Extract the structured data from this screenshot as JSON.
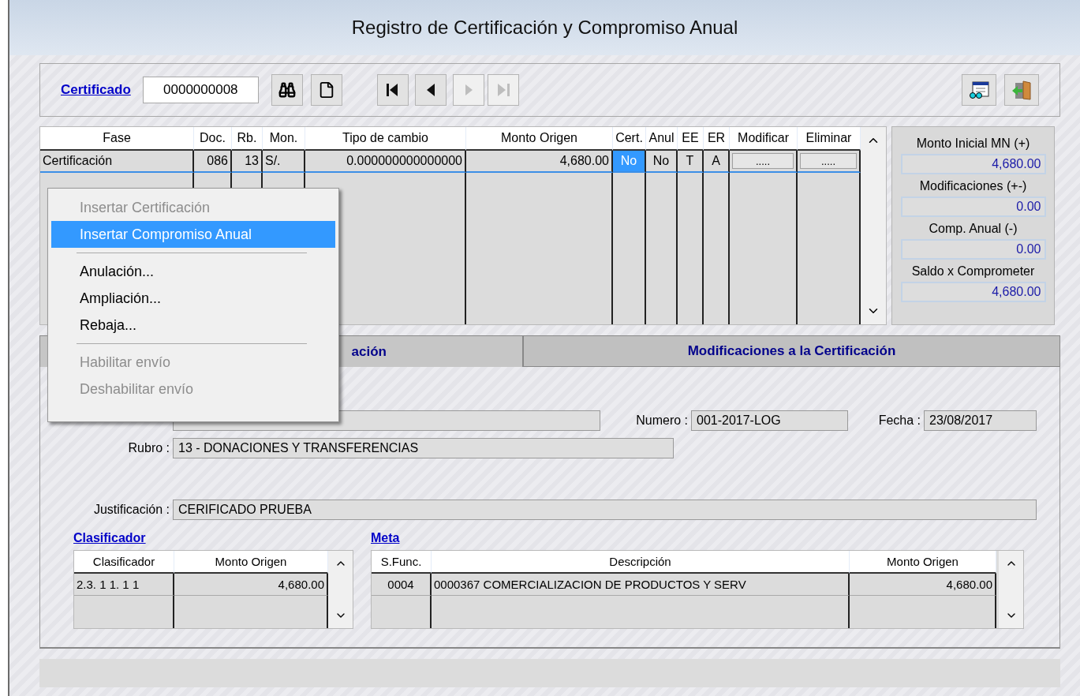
{
  "window": {
    "title": "Registro de Certificación y Compromiso Anual"
  },
  "toolbar": {
    "link": "Certificado",
    "certificate_value": "0000000008",
    "nav_buttons": [
      {
        "kind": "first",
        "disabled": false
      },
      {
        "kind": "prev",
        "disabled": false
      },
      {
        "kind": "next",
        "disabled": true
      },
      {
        "kind": "last",
        "disabled": true
      }
    ]
  },
  "grid": {
    "columns": [
      "Fase",
      "Doc.",
      "Rb.",
      "Mon.",
      "Tipo de cambio",
      "Monto Origen",
      "Cert.",
      "Anul",
      "EE",
      "ER",
      "Modificar",
      "Eliminar"
    ],
    "rows": [
      {
        "selected": true,
        "cells": [
          {
            "kind": "text",
            "text": "Certificación",
            "selected": false
          },
          {
            "kind": "text",
            "text": "086",
            "selected": false
          },
          {
            "kind": "text",
            "text": "13",
            "selected": false
          },
          {
            "kind": "text",
            "text": "S/.",
            "selected": false
          },
          {
            "kind": "text",
            "text": "0.000000000000000",
            "selected": false
          },
          {
            "kind": "text",
            "text": "4,680.00",
            "selected": false
          },
          {
            "kind": "text",
            "text": "No",
            "selected": true
          },
          {
            "kind": "text",
            "text": "No",
            "selected": false
          },
          {
            "kind": "text",
            "text": "T",
            "selected": false
          },
          {
            "kind": "text",
            "text": "A",
            "selected": false
          },
          {
            "kind": "button",
            "text": ".....",
            "selected": false
          },
          {
            "kind": "button",
            "text": ".....",
            "selected": false
          }
        ]
      }
    ]
  },
  "summary": [
    {
      "label": "Monto Inicial MN (+)",
      "value": "4,680.00"
    },
    {
      "label": "Modificaciones (+-)",
      "value": "0.00"
    },
    {
      "label": "Comp. Anual (-)",
      "value": "0.00"
    },
    {
      "label": "Saldo x Comprometer",
      "value": "4,680.00"
    }
  ],
  "context_menu": [
    {
      "kind": "item",
      "label": "Insertar Certificación",
      "disabled": true,
      "selected": false
    },
    {
      "kind": "item",
      "label": "Insertar Compromiso Anual",
      "disabled": false,
      "selected": true
    },
    {
      "kind": "separator"
    },
    {
      "kind": "item",
      "label": "Anulación...",
      "disabled": false,
      "selected": false
    },
    {
      "kind": "item",
      "label": "Ampliación...",
      "disabled": false,
      "selected": false
    },
    {
      "kind": "item",
      "label": "Rebaja...",
      "disabled": false,
      "selected": false
    },
    {
      "kind": "separator"
    },
    {
      "kind": "item",
      "label": "Habilitar envío",
      "disabled": true,
      "selected": false
    },
    {
      "kind": "item",
      "label": "Deshabilitar envío",
      "disabled": true,
      "selected": false
    }
  ],
  "tabs": [
    {
      "label": "ación",
      "selected": true
    },
    {
      "label": "Modificaciones a la Certificación",
      "selected": false
    }
  ],
  "form": {
    "numero_label": "Numero :",
    "numero": "001-2017-LOG",
    "fecha_label": "Fecha :",
    "fecha": "23/08/2017",
    "rubro_label": "Rubro :",
    "rubro": "13 - DONACIONES Y TRANSFERENCIAS",
    "justificacion_label": "Justificación :",
    "justificacion": "CERIFICADO PRUEBA"
  },
  "clasificador": {
    "link": "Clasificador",
    "columns": [
      "Clasificador",
      "Monto Origen"
    ],
    "rows": [
      [
        "2.3. 1 1. 1 1",
        "4,680.00"
      ]
    ]
  },
  "meta": {
    "link": "Meta",
    "columns": [
      "S.Func.",
      "Descripción",
      "Monto Origen"
    ],
    "rows": [
      [
        "0004",
        "0000367  COMERCIALIZACION DE PRODUCTOS Y SERV",
        "4,680.00"
      ]
    ]
  }
}
